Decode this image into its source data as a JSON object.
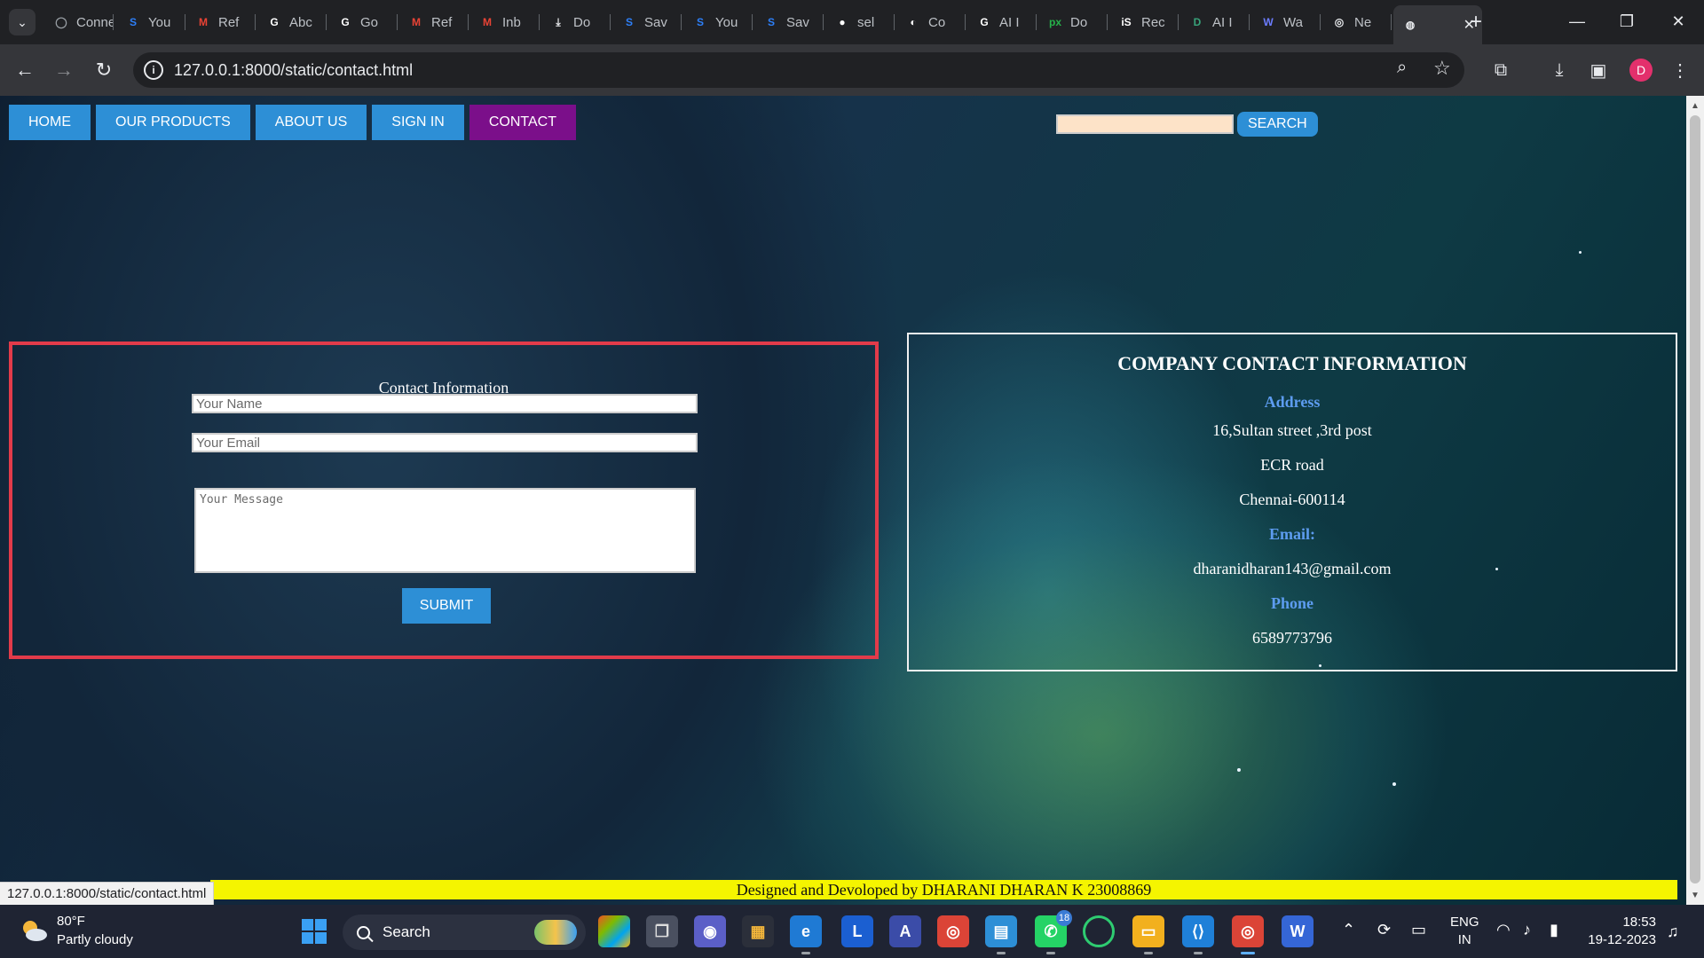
{
  "browser": {
    "tabs": [
      {
        "icon": "globe-icon",
        "label": "Connec",
        "color": "#9aa0a6",
        "glyph": "◯"
      },
      {
        "icon": "s-app-icon",
        "label": "You",
        "color": "#2d7ff9",
        "glyph": "S"
      },
      {
        "icon": "gmail-icon",
        "label": "Ref",
        "color": "#ea4335",
        "glyph": "M"
      },
      {
        "icon": "google-icon",
        "label": "Abc",
        "color": "#ffffff",
        "glyph": "G"
      },
      {
        "icon": "google-icon",
        "label": "Go",
        "color": "#ffffff",
        "glyph": "G"
      },
      {
        "icon": "gmail-icon",
        "label": "Ref",
        "color": "#ea4335",
        "glyph": "M"
      },
      {
        "icon": "gmail-icon",
        "label": "Inb",
        "color": "#ea4335",
        "glyph": "M"
      },
      {
        "icon": "download-icon",
        "label": "Do",
        "color": "#e8eaed",
        "glyph": "⤓"
      },
      {
        "icon": "s-app-icon",
        "label": "Sav",
        "color": "#2d7ff9",
        "glyph": "S"
      },
      {
        "icon": "s-app-icon",
        "label": "You",
        "color": "#2d7ff9",
        "glyph": "S"
      },
      {
        "icon": "s-app-icon",
        "label": "Sav",
        "color": "#2d7ff9",
        "glyph": "S"
      },
      {
        "icon": "github-icon",
        "label": "sel",
        "color": "#ffffff",
        "glyph": "●"
      },
      {
        "icon": "globe-icon",
        "label": "Co",
        "color": "#ffffff",
        "glyph": "◐"
      },
      {
        "icon": "google-icon",
        "label": "AI I",
        "color": "#ffffff",
        "glyph": "G"
      },
      {
        "icon": "pixlr-icon",
        "label": "Do",
        "color": "#26b34a",
        "glyph": "px"
      },
      {
        "icon": "is-icon",
        "label": "Rec",
        "color": "#ffffff",
        "glyph": "iS"
      },
      {
        "icon": "app-icon",
        "label": "AI I",
        "color": "#38a37a",
        "glyph": "D"
      },
      {
        "icon": "w-app-icon",
        "label": "Wa",
        "color": "#6b7cff",
        "glyph": "W"
      },
      {
        "icon": "chrome-icon",
        "label": "Ne",
        "color": "#e8eaed",
        "glyph": "◎"
      }
    ],
    "active_tab_icon": "globe-icon",
    "url": "127.0.0.1:8000/static/contact.html",
    "profile_initial": "D"
  },
  "site": {
    "nav": [
      "HOME",
      "OUR PRODUCTS",
      "ABOUT US",
      "SIGN IN",
      "CONTACT"
    ],
    "active_nav": "CONTACT",
    "search_button": "SEARCH",
    "form": {
      "title": "Contact Information",
      "name_placeholder": "Your Name",
      "email_placeholder": "Your Email",
      "message_placeholder": "Your Message",
      "submit": "SUBMIT"
    },
    "company": {
      "title": "COMPANY CONTACT INFORMATION",
      "address_label": "Address",
      "address_line1": "16,Sultan street ,3rd post",
      "address_line2": "ECR road",
      "address_line3": "Chennai-600114",
      "email_label": "Email:",
      "email": "dharanidharan143@gmail.com",
      "phone_label": "Phone",
      "phone": "6589773796"
    },
    "footer": "Designed and Devoloped by DHARANI DHARAN K 23008869",
    "status_url": "127.0.0.1:8000/static/contact.html"
  },
  "taskbar": {
    "temperature": "80°F",
    "weather": "Partly cloudy",
    "search": "Search",
    "whatsapp_badge": "18",
    "language": "ENG",
    "region": "IN",
    "time": "18:53",
    "date": "19-12-2023"
  },
  "colors": {
    "nav_blue": "#2d8fd6",
    "nav_active": "#7b0f8a",
    "form_border": "#e23b4a",
    "label_blue": "#5d9cf0",
    "footer_bg": "#f5f500"
  }
}
